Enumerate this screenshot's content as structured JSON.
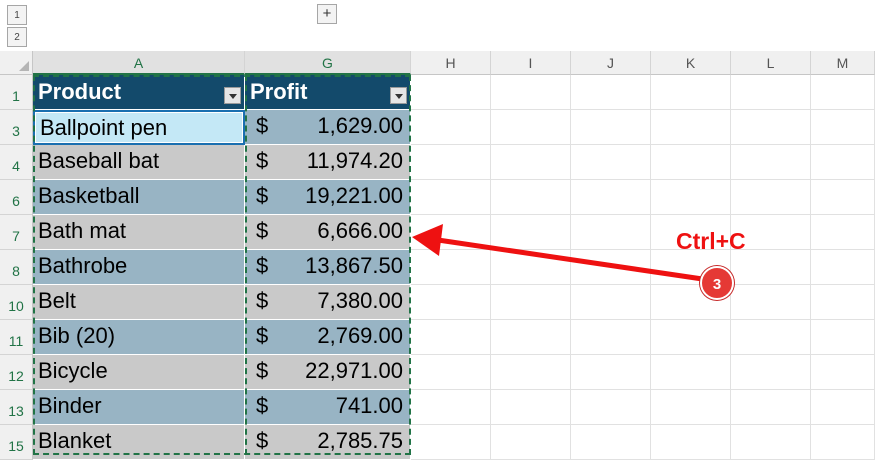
{
  "outline": {
    "levels": [
      "1",
      "2"
    ],
    "expand_symbol": "+"
  },
  "columns": [
    "A",
    "G",
    "H",
    "I",
    "J",
    "K",
    "L",
    "M"
  ],
  "table": {
    "header_row_number": "1",
    "headers": [
      "Product",
      "Profit"
    ],
    "currency_symbol": "$",
    "rows": [
      {
        "row": "3",
        "product": "Ballpoint pen",
        "profit": "1,629.00"
      },
      {
        "row": "4",
        "product": "Baseball bat",
        "profit": "11,974.20"
      },
      {
        "row": "6",
        "product": "Basketball",
        "profit": "19,221.00"
      },
      {
        "row": "7",
        "product": "Bath mat",
        "profit": "6,666.00"
      },
      {
        "row": "8",
        "product": "Bathrobe",
        "profit": "13,867.50"
      },
      {
        "row": "10",
        "product": "Belt",
        "profit": "7,380.00"
      },
      {
        "row": "11",
        "product": "Bib (20)",
        "profit": "2,769.00"
      },
      {
        "row": "12",
        "product": "Bicycle",
        "profit": "22,971.00"
      },
      {
        "row": "13",
        "product": "Binder",
        "profit": "741.00"
      },
      {
        "row": "15",
        "product": "Blanket",
        "profit": "2,785.75"
      }
    ]
  },
  "annotation": {
    "shortcut": "Ctrl+C",
    "step": "3"
  },
  "colors": {
    "header_fill": "#134a6b",
    "row_blue": "#98b4c4",
    "row_gray": "#c9c9c9",
    "active_cell": "#c4e8f6",
    "marquee": "#217346",
    "arrow": "#ee1111"
  }
}
